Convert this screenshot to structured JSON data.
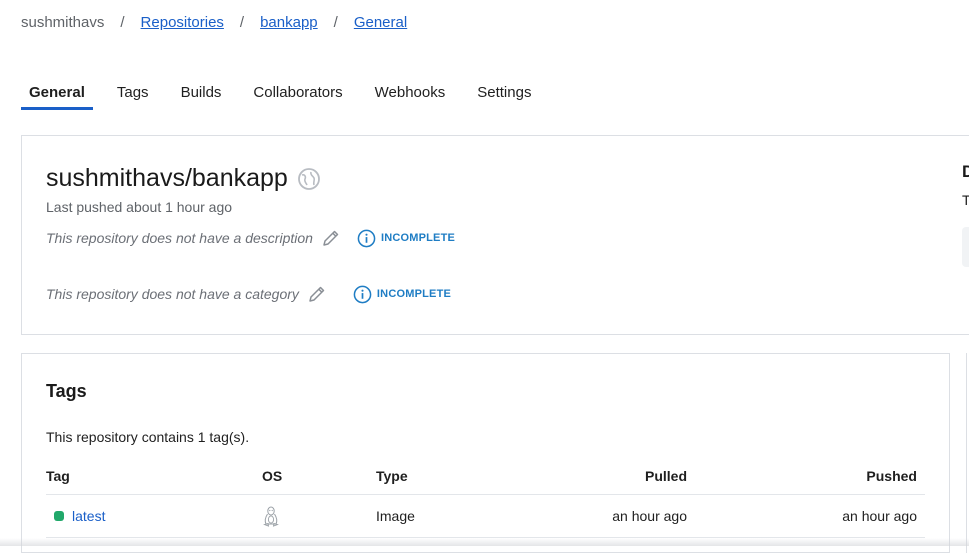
{
  "breadcrumb": {
    "user": "sushmithavs",
    "repositories": "Repositories",
    "repo": "bankapp",
    "current": "General",
    "separator": "/"
  },
  "tabs": [
    {
      "label": "General",
      "active": true
    },
    {
      "label": "Tags"
    },
    {
      "label": "Builds"
    },
    {
      "label": "Collaborators"
    },
    {
      "label": "Webhooks"
    },
    {
      "label": "Settings"
    }
  ],
  "repo": {
    "title": "sushmithavs/bankapp",
    "last_pushed": "Last pushed about 1 hour ago",
    "description_text": "This repository does not have a description",
    "category_text": "This repository does not have a category",
    "incomplete_label": "INCOMPLETE",
    "side_peek_heading": "D",
    "side_peek_text": "T"
  },
  "tags": {
    "heading": "Tags",
    "count_text": "This repository contains 1 tag(s).",
    "columns": {
      "tag": "Tag",
      "os": "OS",
      "type": "Type",
      "pulled": "Pulled",
      "pushed": "Pushed"
    },
    "rows": [
      {
        "tag": "latest",
        "os_icon": "linux-icon",
        "type": "Image",
        "pulled": "an hour ago",
        "pushed": "an hour ago",
        "status_color": "#21a86a"
      }
    ]
  },
  "colors": {
    "accent": "#1a5fc8",
    "incomplete": "#1f7dc4",
    "active_dot": "#21a86a"
  }
}
